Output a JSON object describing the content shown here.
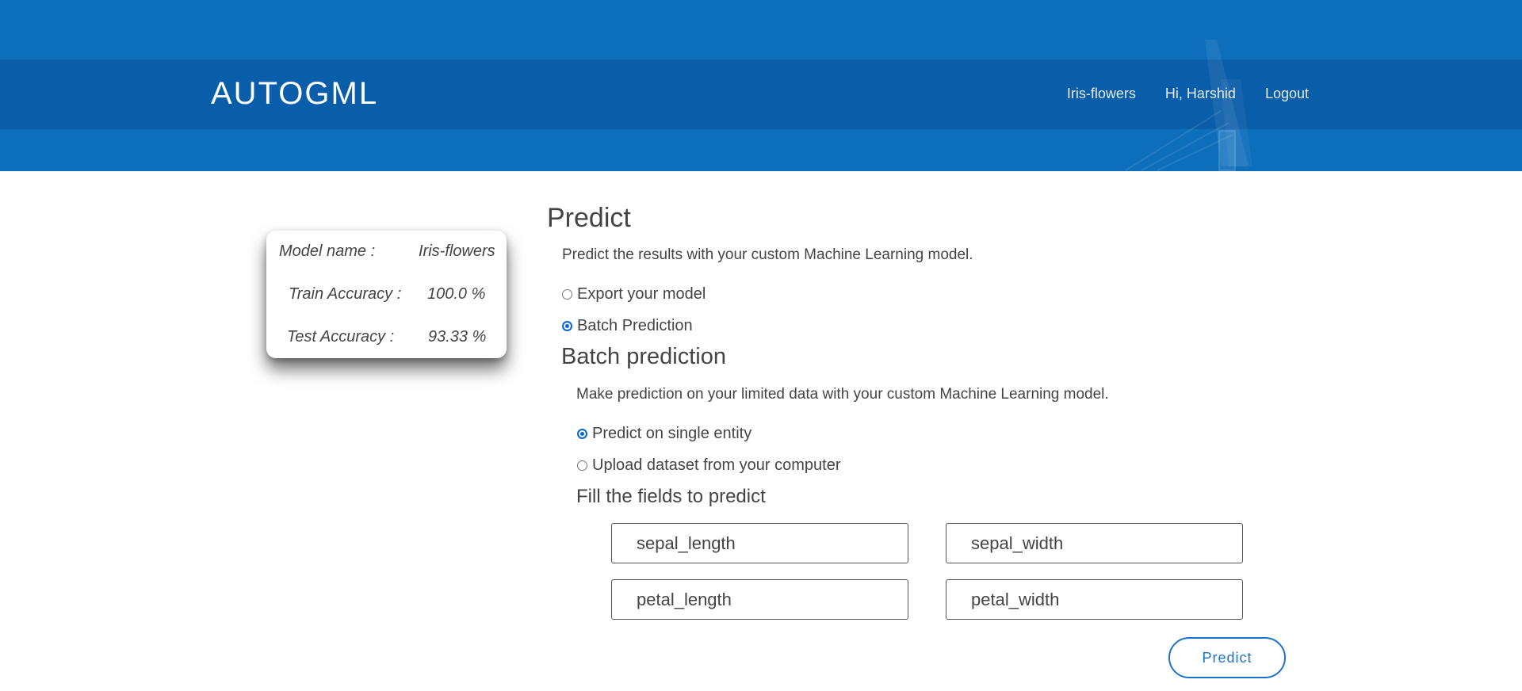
{
  "header": {
    "brand": "AUTOGML",
    "nav": {
      "project": "Iris-flowers",
      "greeting": "Hi, Harshid",
      "logout": "Logout"
    }
  },
  "model_info": {
    "name_label": "Model name :",
    "name_value": "Iris-flowers",
    "train_label": "Train Accuracy :",
    "train_value": "100.0 %",
    "test_label": "Test Accuracy :",
    "test_value": "93.33 %"
  },
  "predict": {
    "title": "Predict",
    "description": "Predict the results with your custom Machine Learning model.",
    "options": [
      {
        "label": "Export your model",
        "checked": false
      },
      {
        "label": "Batch Prediction",
        "checked": true
      }
    ]
  },
  "batch": {
    "title": "Batch prediction",
    "description": "Make prediction on your limited data with your custom Machine Learning model.",
    "options": [
      {
        "label": "Predict on single entity",
        "checked": true
      },
      {
        "label": "Upload dataset from your computer",
        "checked": false
      }
    ],
    "fill_title": "Fill the fields to predict",
    "fields": [
      {
        "placeholder": "sepal_length",
        "value": ""
      },
      {
        "placeholder": "sepal_width",
        "value": ""
      },
      {
        "placeholder": "petal_length",
        "value": ""
      },
      {
        "placeholder": "petal_width",
        "value": ""
      }
    ],
    "submit_label": "Predict"
  },
  "colors": {
    "header_bg": "#0d6ebc",
    "accent": "#1a73c9",
    "radio_checked": "#0a69d1",
    "text": "#444444"
  }
}
